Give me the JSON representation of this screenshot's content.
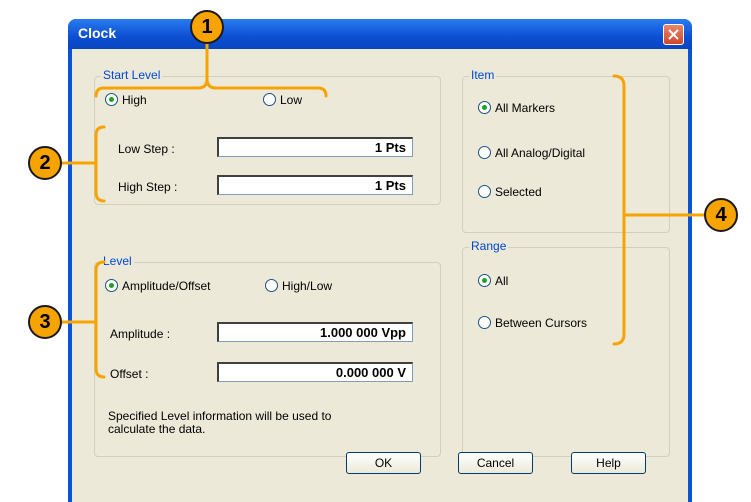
{
  "window": {
    "title": "Clock"
  },
  "start_level": {
    "legend": "Start Level",
    "high": "High",
    "low": "Low",
    "selected": "High",
    "low_step_label": "Low Step :",
    "low_step_value": "1 Pts",
    "high_step_label": "High Step :",
    "high_step_value": "1 Pts"
  },
  "level": {
    "legend": "Level",
    "amp_offset": "Amplitude/Offset",
    "high_low": "High/Low",
    "selected": "Amplitude/Offset",
    "amplitude_label": "Amplitude :",
    "amplitude_value": "1.000 000 Vpp",
    "offset_label": "Offset :",
    "offset_value": "0.000 000 V",
    "note_line1": "Specified Level information will be used to",
    "note_line2": "calculate the data."
  },
  "item": {
    "legend": "Item",
    "options": [
      "All Markers",
      "All Analog/Digital",
      "Selected"
    ],
    "selected": "All Markers"
  },
  "range": {
    "legend": "Range",
    "options": [
      "All",
      "Between Cursors"
    ],
    "selected": "All"
  },
  "buttons": {
    "ok": "OK",
    "cancel": "Cancel",
    "help": "Help"
  },
  "callouts": [
    "1",
    "2",
    "3",
    "4"
  ],
  "colors": {
    "callout": "#f7a400",
    "titlebar": "#0c4fd2",
    "dialog": "#ece9d8"
  },
  "icons": {
    "close": "close-icon",
    "radio": "radio-icon"
  }
}
